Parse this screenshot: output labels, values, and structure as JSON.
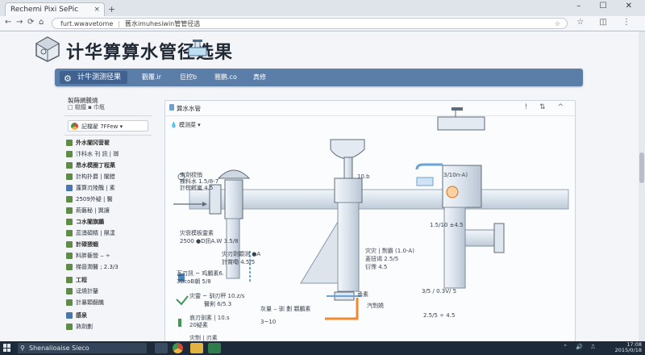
{
  "browser": {
    "tab_title": "Rechemi Pixi SePic",
    "tab_close": "×",
    "new_tab": "+",
    "window_controls": "–  ☐  ✕",
    "address_host": "furt.wwavetome",
    "address_path": "舊水imuhesiwin管管径选",
    "back": "←",
    "forward": "→",
    "reload": "⟳",
    "home": "⌂",
    "star": "☆",
    "toolbar_right": "☆ ◫ ⋮"
  },
  "page": {
    "title": "计华算算水管径选果"
  },
  "menubar": {
    "brand": "计牛测测径果",
    "items": [
      "觀覆.ir",
      "巨控b",
      "雅鹏.co",
      "真修"
    ]
  },
  "sidebar": {
    "heading": "製蒔網騰燒",
    "subheading": "□ 糍鐵 ▪ 巾瓶",
    "select_label": "記檔翟 7FFew ▾",
    "rows": [
      {
        "text": "外水闇冈营翟",
        "style": "sec",
        "icon": "green"
      },
      {
        "text": "汴科水 刊 訊 | 瑯",
        "style": "",
        "icon": "green"
      },
      {
        "text": "昂水模圈丁程菓",
        "style": "sec",
        "icon": "green"
      },
      {
        "text": "計构扑爵 | 闇錯",
        "style": "",
        "icon": "green"
      },
      {
        "text": "蓬算刃陸醜 | 素",
        "style": "",
        "icon": "blue"
      },
      {
        "text": "2509外疑 | 醫",
        "style": "",
        "icon": "green"
      },
      {
        "text": "荊藝秘 | 巽讓",
        "style": "",
        "icon": "green"
      },
      {
        "text": "コ水闇旗鵬",
        "style": "sec",
        "icon": "green"
      },
      {
        "text": "蕊湧碩精 | 隰漾",
        "style": "",
        "icon": "green"
      },
      {
        "text": "計碌猥蝦",
        "style": "sec",
        "icon": "green"
      },
      {
        "text": "料胖藝營 ‒ ÷",
        "style": "",
        "icon": "green"
      },
      {
        "text": "梯晉潤醫 ; 2.3/3",
        "style": "",
        "icon": "green"
      },
      {
        "text": "工程",
        "style": "sec",
        "icon": "green"
      },
      {
        "text": "迳燒計鑿",
        "style": "",
        "icon": "green"
      },
      {
        "text": "計暴顆翻饑",
        "style": "",
        "icon": "green"
      },
      {
        "text": "感泉",
        "style": "sec",
        "icon": "blue"
      },
      {
        "text": "熟劑劃",
        "style": "",
        "icon": "green"
      }
    ]
  },
  "panel": {
    "title": "算水水管",
    "header_icons": "! ⇅ ^",
    "dropdown": "模测菜 ▾",
    "labels": [
      "來劑棂悄",
      "辣料水 1.5/8-7",
      "計棕鰐嵐 4.5",
      "10.b",
      "3/10n-A)",
      "灾衰模板靈素",
      "2500 ●D訊A.W  3.5/8",
      "灾刃劑顆测 ●A",
      "計賞嘞 4.5/5",
      "灾灾 | 剽霸 (1.0-A)",
      "菱扭谒 2.5/5",
      "衍霈 4.5",
      "瓦刃訊 ~ 鸡鵬素6.",
      "3BcoB朝 5/8",
      "灾靈 ~ 驯刃秤 10.z/s",
      "醫剣 6/5.3",
      "承素",
      "哀刃驯素 | 10.s",
      "20疑素",
      "灾剽 | 刃素",
      "灰量 ‒ 驯 劃 顆鵬素",
      "3/5 / 0.3V/ 5",
      "1.5/10 ±4.5",
      "3~10",
      "汽剽嬈",
      "2.5/5 ÷ 4.5"
    ]
  },
  "taskbar": {
    "search": "Shenalioaise Sieco",
    "clock_time": "17:08",
    "clock_date": "2015/0/18",
    "tray": "⌃ 🔊 ⎍"
  },
  "colors": {
    "menubar": "#5b7ea8",
    "brand": "#3f6290",
    "pipe": "#dfe6ee",
    "accent_orange": "#f08a2e",
    "accent_blue": "#6aa3d6"
  }
}
